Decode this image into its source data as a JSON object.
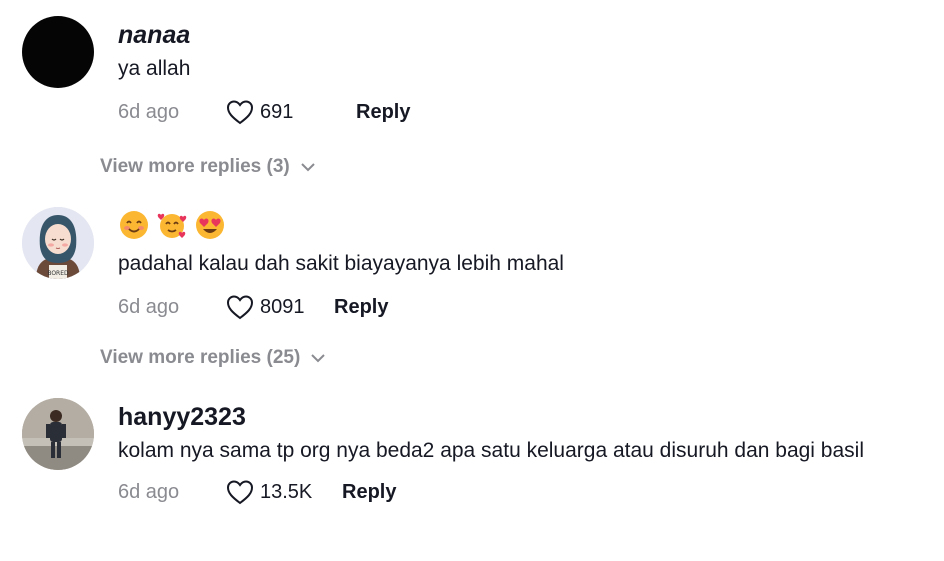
{
  "comments": [
    {
      "username": "nanaa",
      "text": "ya allah",
      "time": "6d ago",
      "likes": "691",
      "reply_label": "Reply",
      "view_more": "View more replies (3)"
    },
    {
      "username": "",
      "emojis": [
        "smiling-face-emoji",
        "face-with-hearts-emoji",
        "heart-eyes-emoji"
      ],
      "text": "padahal kalau dah sakit biayayanya lebih mahal",
      "time": "6d ago",
      "likes": "8091",
      "reply_label": "Reply",
      "view_more": "View more replies (25)"
    },
    {
      "username": "hanyy2323",
      "text": "kolam nya sama tp org nya beda2 apa satu keluarga atau disuruh dan bagi basil",
      "time": "6d ago",
      "likes": "13.5K",
      "reply_label": "Reply"
    }
  ],
  "colors": {
    "text": "#161823",
    "muted": "#8a8b91"
  }
}
